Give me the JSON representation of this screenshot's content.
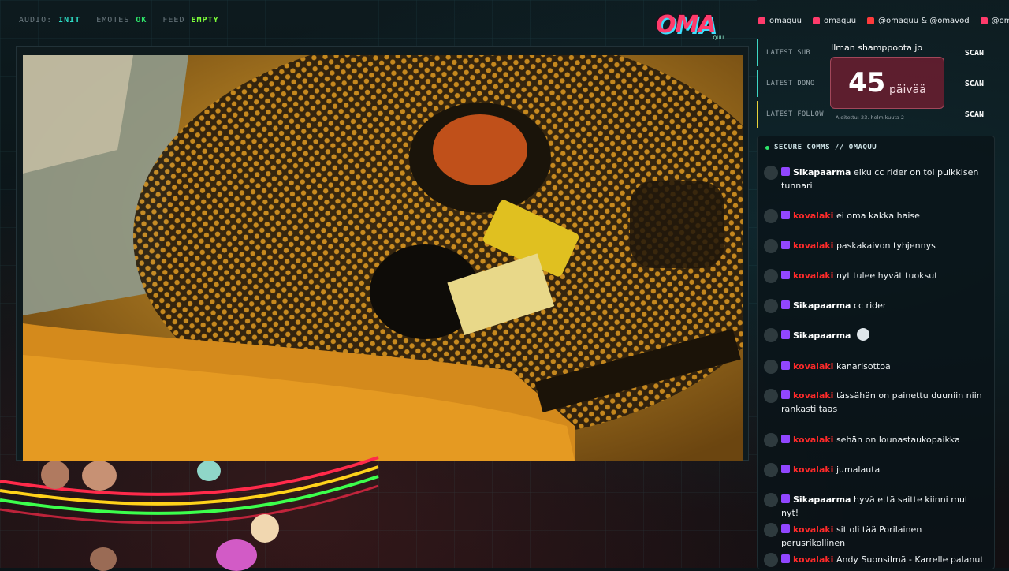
{
  "status": [
    {
      "key": "AUDIO:",
      "value": "INIT",
      "color": "#2ee0c8"
    },
    {
      "key": "EMOTES",
      "value": "OK",
      "color": "#2ee56a"
    },
    {
      "key": "FEED",
      "value": "EMPTY",
      "color": "#7dff3a"
    }
  ],
  "logo": {
    "text": "OMA",
    "sub": "QUU"
  },
  "social": [
    {
      "icon": "twitch-icon",
      "label": "omaquu",
      "color": "#ff3b6b"
    },
    {
      "icon": "instagram-icon",
      "label": "omaquu",
      "color": "#ff3b6b"
    },
    {
      "icon": "youtube-icon",
      "label": "@omaquu & @omavod",
      "color": "#ff3b3b"
    },
    {
      "icon": "tiktok-icon",
      "label": "@omaquu &",
      "color": "#ff3b6b"
    }
  ],
  "events": [
    {
      "label": "LATEST SUB",
      "value": "SCAN"
    },
    {
      "label": "LATEST DONO",
      "value": "SCAN"
    },
    {
      "label": "LATEST FOLLOW",
      "value": "SCAN"
    }
  ],
  "counter": {
    "top": "Ilman shamppoota jo",
    "number": "45",
    "unit": "päivää",
    "sub": "Aloitettu: 23. helmikuuta 2"
  },
  "chat": {
    "header": "SECURE COMMS // OMAQUU",
    "messages": [
      {
        "user": "Sikapaarma",
        "user_color": "#ffffff",
        "text": "eiku cc rider on toi pulkkisen tunnari",
        "emote": false
      },
      {
        "user": "kovalaki",
        "user_color": "#ff2a2a",
        "text": "ei oma kakka haise",
        "emote": false
      },
      {
        "user": "kovalaki",
        "user_color": "#ff2a2a",
        "text": "paskakaivon tyhjennys",
        "emote": false
      },
      {
        "user": "kovalaki",
        "user_color": "#ff2a2a",
        "text": "nyt tulee hyvät tuoksut",
        "emote": false
      },
      {
        "user": "Sikapaarma",
        "user_color": "#ffffff",
        "text": "cc rider",
        "emote": false
      },
      {
        "user": "Sikapaarma",
        "user_color": "#ffffff",
        "text": "",
        "emote": true
      },
      {
        "user": "kovalaki",
        "user_color": "#ff2a2a",
        "text": "kanarisottoa",
        "emote": false
      },
      {
        "user": "kovalaki",
        "user_color": "#ff2a2a",
        "text": "tässähän on painettu duuniin niin rankasti taas",
        "emote": false
      },
      {
        "user": "kovalaki",
        "user_color": "#ff2a2a",
        "text": "sehän on lounastaukopaikka",
        "emote": false
      },
      {
        "user": "kovalaki",
        "user_color": "#ff2a2a",
        "text": "jumalauta",
        "emote": false
      },
      {
        "user": "Sikapaarma",
        "user_color": "#ffffff",
        "text": "hyvä että saitte kiinni mut nyt!",
        "emote": false
      },
      {
        "user": "kovalaki",
        "user_color": "#ff2a2a",
        "text": "sit oli tää Porilainen perusrikollinen",
        "emote": false
      },
      {
        "user": "kovalaki",
        "user_color": "#ff2a2a",
        "text": "Andy Suonsilmä - Karrelle palanut",
        "emote": false
      }
    ]
  }
}
